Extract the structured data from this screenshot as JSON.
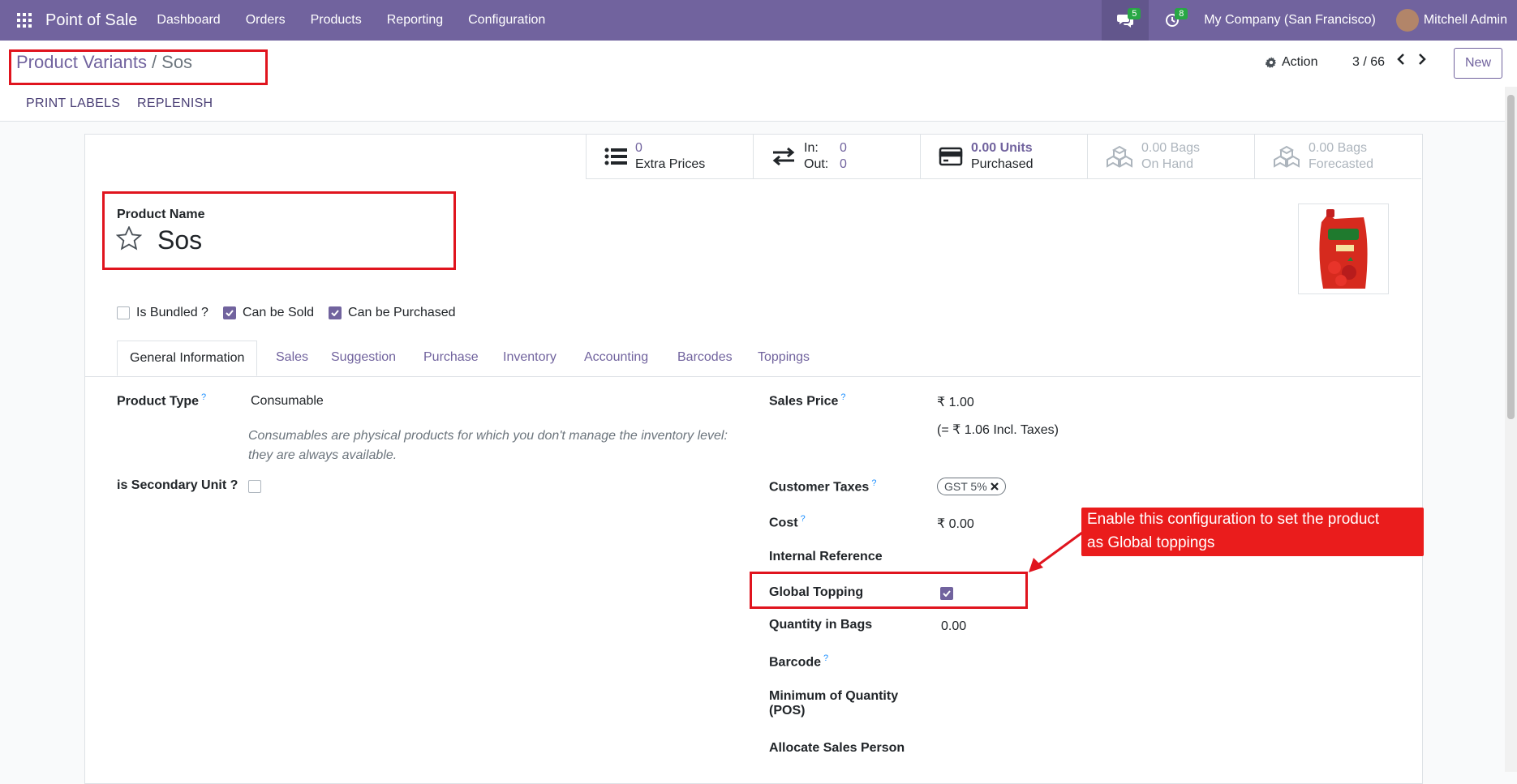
{
  "navbar": {
    "brand": "Point of Sale",
    "menu": [
      "Dashboard",
      "Orders",
      "Products",
      "Reporting",
      "Configuration"
    ],
    "chat_count": "5",
    "activity_count": "8",
    "company": "My Company (San Francisco)",
    "user": "Mitchell Admin"
  },
  "control": {
    "breadcrumb_parent": "Product Variants",
    "breadcrumb_sep": "/",
    "breadcrumb_current": "Sos",
    "action_label": "Action",
    "pager": "3 / 66",
    "new_label": "New"
  },
  "header_buttons": [
    "PRINT LABELS",
    "REPLENISH"
  ],
  "smart_buttons": {
    "extra_prices_value": "0",
    "extra_prices_label": "Extra Prices",
    "in_label": "In:",
    "in_value": "0",
    "out_label": "Out:",
    "out_value": "0",
    "purchased_value": "0.00 Units",
    "purchased_label": "Purchased",
    "onhand_value": "0.00 Bags",
    "onhand_label": "On Hand",
    "forecast_value": "0.00 Bags",
    "forecast_label": "Forecasted"
  },
  "product": {
    "name_label": "Product Name",
    "name": "Sos"
  },
  "checkboxes": [
    {
      "label": "Is Bundled ?",
      "checked": false
    },
    {
      "label": "Can be Sold",
      "checked": true
    },
    {
      "label": "Can be Purchased",
      "checked": true
    }
  ],
  "tabs": [
    "General Information",
    "Sales",
    "Suggestion",
    "Purchase",
    "Inventory",
    "Accounting",
    "Barcodes",
    "Toppings"
  ],
  "left_fields": {
    "product_type_label": "Product Type",
    "product_type_value": "Consumable",
    "product_type_note": "Consumables are physical products for which you don't manage the inventory level: they are always available.",
    "secondary_unit_label": "is Secondary Unit ?"
  },
  "right_fields": {
    "sales_price_label": "Sales Price",
    "sales_price_value": "₹ 1.00",
    "incl_taxes": "(= ₹ 1.06 Incl. Taxes)",
    "customer_taxes_label": "Customer Taxes",
    "tax_tag": "GST 5%",
    "cost_label": "Cost",
    "cost_value": "₹ 0.00",
    "internal_ref_label": "Internal Reference",
    "global_topping_label": "Global Topping",
    "global_topping_checked": true,
    "qty_bags_label": "Quantity in Bags",
    "qty_bags_value": "0.00",
    "barcode_label": "Barcode",
    "min_qty_label_1": "Minimum of Quantity",
    "min_qty_label_2": "(POS)",
    "allocate_label": "Allocate Sales Person"
  },
  "help_mark": "?",
  "annotation": {
    "line1": "Enable this configuration to set the product",
    "line2": "as Global toppings"
  },
  "colors": {
    "brand": "#71639e",
    "annotation": "#e0141e",
    "help": "#1e90ff"
  }
}
